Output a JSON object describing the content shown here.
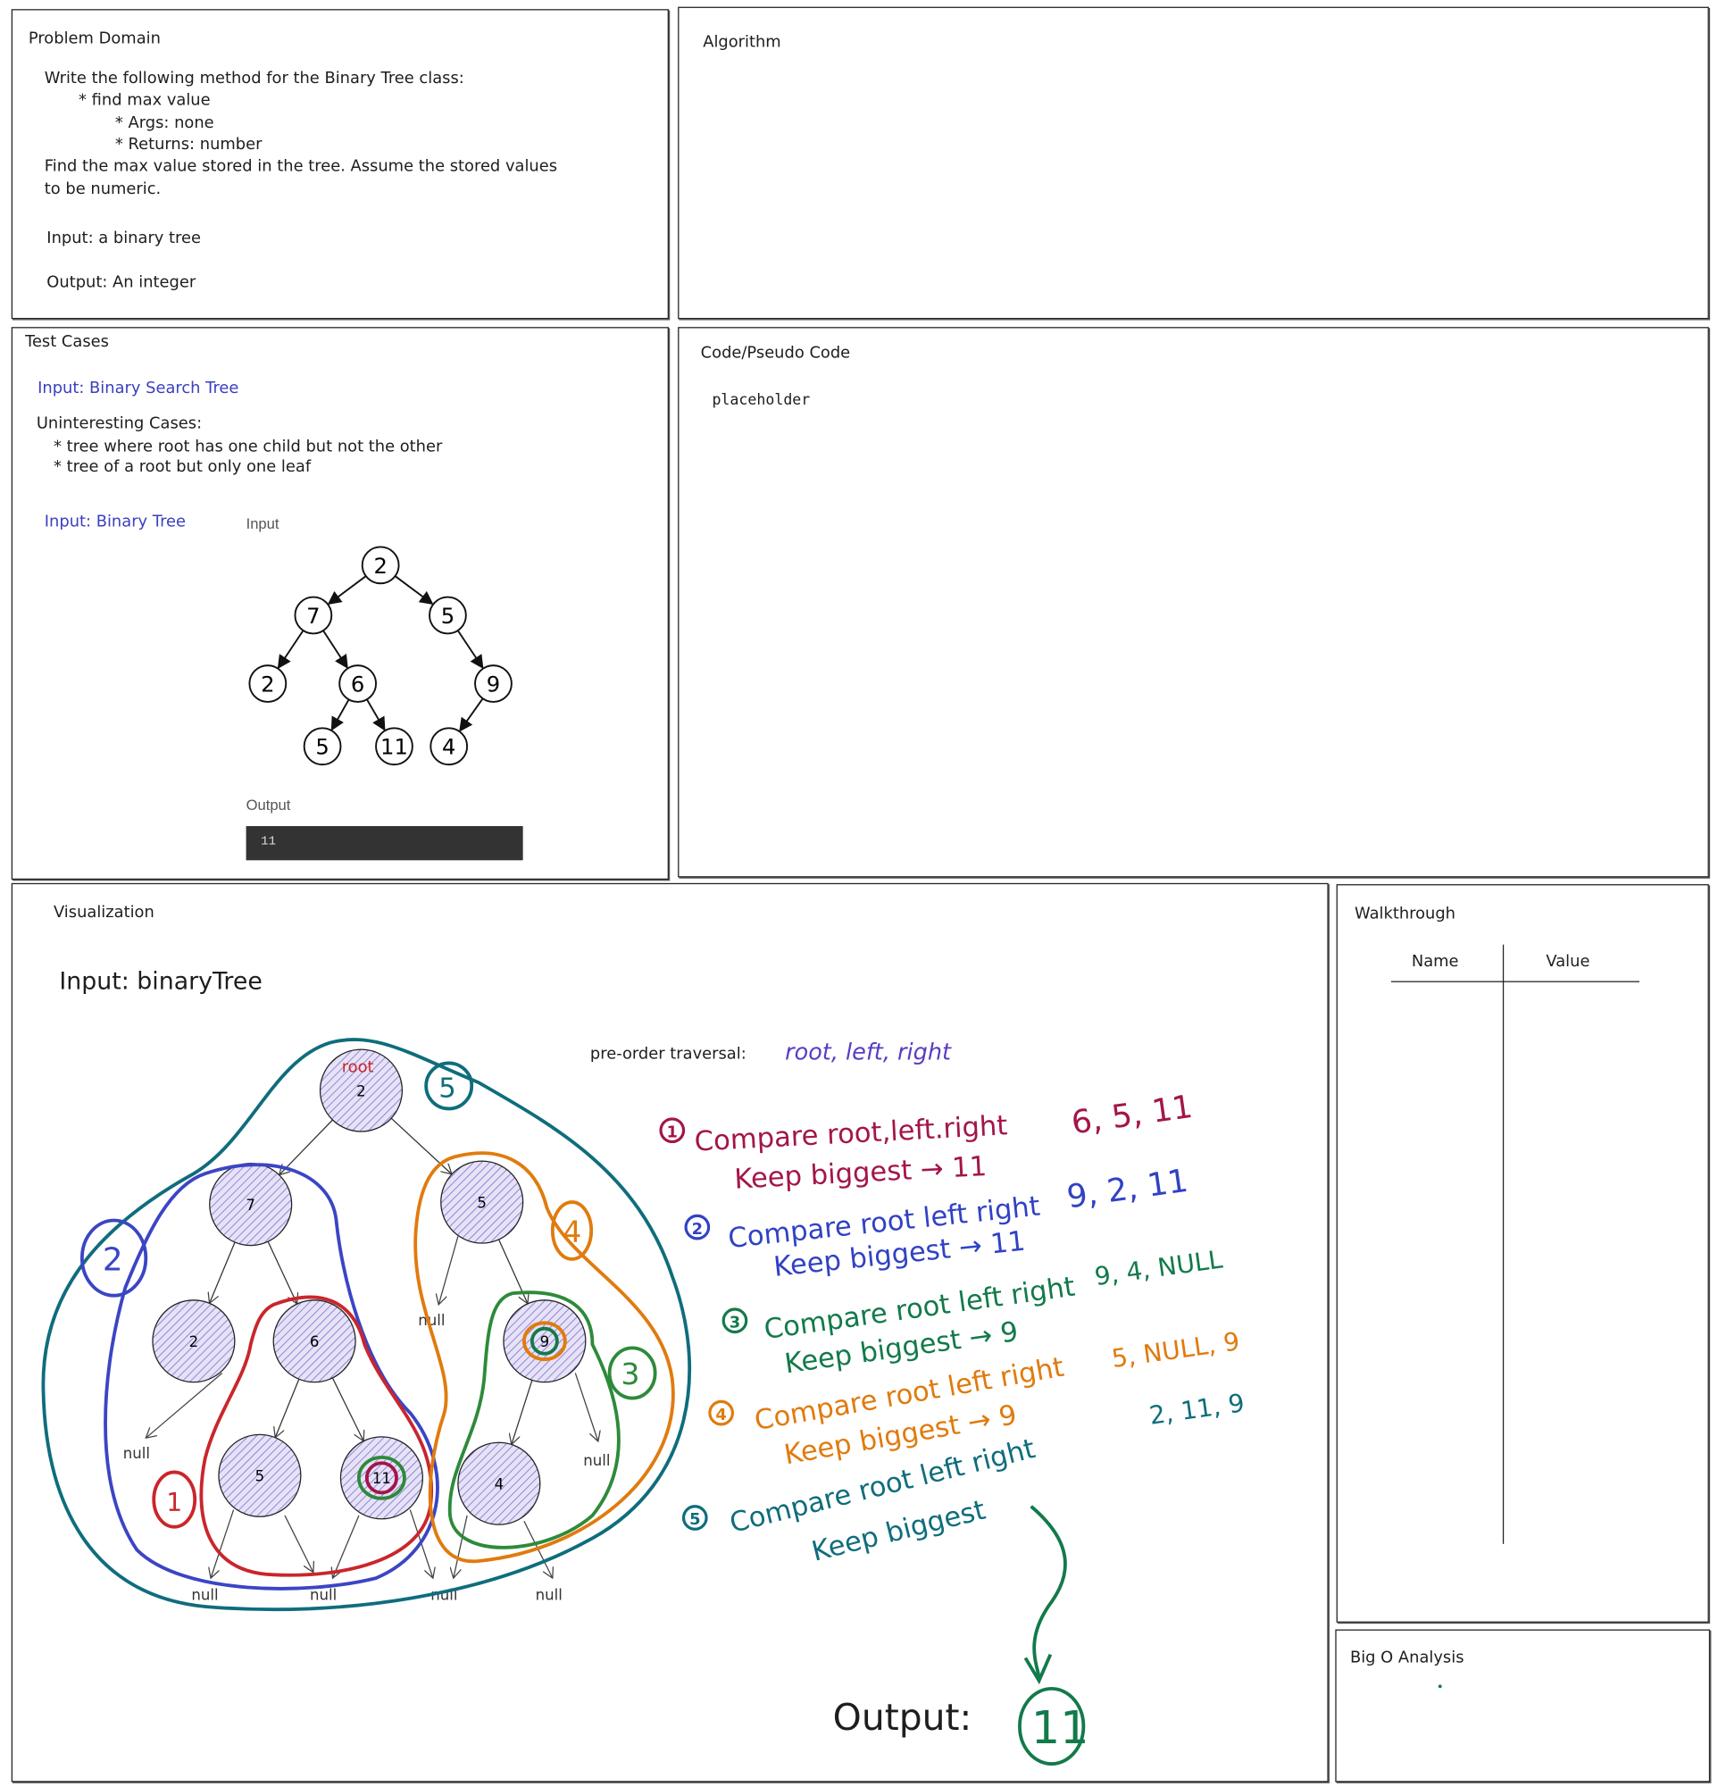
{
  "problem_domain": {
    "title": "Problem Domain",
    "lines": [
      "Write the following method for the Binary Tree class:",
      "* find max value",
      "* Args: none",
      "* Returns: number",
      "Find the max value stored in the tree. Assume the stored values",
      "to be numeric."
    ],
    "input": "Input: a binary tree",
    "output": "Output: An integer"
  },
  "algorithm": {
    "title": "Algorithm"
  },
  "test_cases": {
    "title": "Test Cases",
    "bst_input": "Input: Binary Search Tree",
    "uninteresting_title": "Uninteresting Cases:",
    "uninteresting": [
      "* tree where root has one child but not the other",
      "* tree of a root but only one leaf"
    ],
    "bt_input": "Input: Binary Tree",
    "input_label": "Input",
    "tree_nodes": [
      "2",
      "7",
      "5",
      "2",
      "6",
      "9",
      "5",
      "11",
      "4"
    ],
    "output_label": "Output",
    "output_value": "11"
  },
  "code": {
    "title": "Code/Pseudo Code",
    "body": "placeholder"
  },
  "visualization": {
    "title": "Visualization",
    "input": "Input: binaryTree",
    "root_label": "root",
    "tree_nodes": [
      "2",
      "7",
      "5",
      "2",
      "6",
      "9",
      "5",
      "11",
      "4"
    ],
    "null_label": "null",
    "traversal_label": "pre-order traversal:",
    "traversal_order": "root, left, right",
    "region_numbers": [
      "1",
      "2",
      "3",
      "4",
      "5"
    ],
    "steps": [
      {
        "num": "1",
        "line1": "Compare root,left.right",
        "line2": "Keep biggest → 11",
        "values": "6, 5, 11",
        "color": "#a3154a"
      },
      {
        "num": "2",
        "line1": "Compare root left right",
        "line2": "Keep biggest → 11",
        "values": "9, 2, 11",
        "color": "#3142c4"
      },
      {
        "num": "3",
        "line1": "Compare root left right",
        "line2": "Keep biggest → 9",
        "values": "9, 4, NULL",
        "color": "#137a4a"
      },
      {
        "num": "4",
        "line1": "Compare root left right",
        "line2": "Keep biggest → 9",
        "values": "5, NULL, 9",
        "color": "#e07b0e"
      },
      {
        "num": "5",
        "line1": "Compare root left right",
        "line2": "Keep biggest",
        "values": "2, 11, 9",
        "color": "#0f6d7c"
      }
    ],
    "output_label": "Output:",
    "output_value": "11"
  },
  "walkthrough": {
    "title": "Walkthrough",
    "col_name": "Name",
    "col_value": "Value"
  },
  "big_o": {
    "title": "Big O Analysis"
  }
}
